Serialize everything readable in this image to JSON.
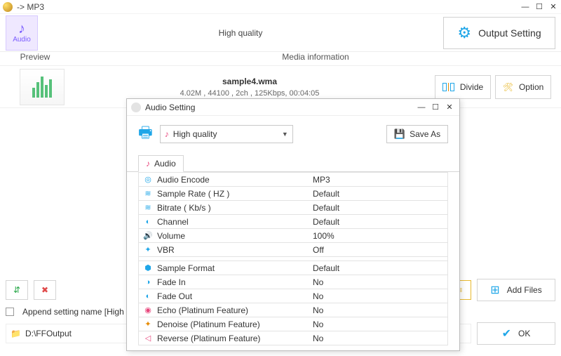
{
  "window": {
    "title": "-> MP3",
    "min": "—",
    "max": "☐",
    "close": "✕"
  },
  "top": {
    "audio_label": "Audio",
    "quality": "High quality",
    "output_setting": "Output Setting"
  },
  "headers": {
    "preview": "Preview",
    "media_info": "Media information"
  },
  "media": {
    "filename": "sample4.wma",
    "meta": "4.02M , 44100 , 2ch , 125Kbps, 00:04:05",
    "divide": "Divide",
    "option": "Option"
  },
  "bottom": {
    "append_label": "Append setting name [High quality]",
    "output_dir": "D:\\FFOutput",
    "add_files": "Add Files",
    "ok": "OK"
  },
  "dialog": {
    "title": "Audio Setting",
    "preset": "High quality",
    "save_as": "Save As",
    "tab_audio": "Audio",
    "rows": [
      {
        "k": "Audio Encode",
        "v": "MP3"
      },
      {
        "k": "Sample Rate ( HZ )",
        "v": "Default"
      },
      {
        "k": "Bitrate ( Kb/s )",
        "v": "Default"
      },
      {
        "k": "Channel",
        "v": "Default"
      },
      {
        "k": "Volume",
        "v": "100%"
      },
      {
        "k": "VBR",
        "v": "Off"
      },
      {
        "k": "Sample Format",
        "v": "Default"
      },
      {
        "k": "Fade In",
        "v": "No"
      },
      {
        "k": "Fade Out",
        "v": "No"
      },
      {
        "k": "Echo (Platinum Feature)",
        "v": "No"
      },
      {
        "k": "Denoise (Platinum Feature)",
        "v": "No"
      },
      {
        "k": "Reverse (Platinum Feature)",
        "v": "No"
      }
    ]
  }
}
